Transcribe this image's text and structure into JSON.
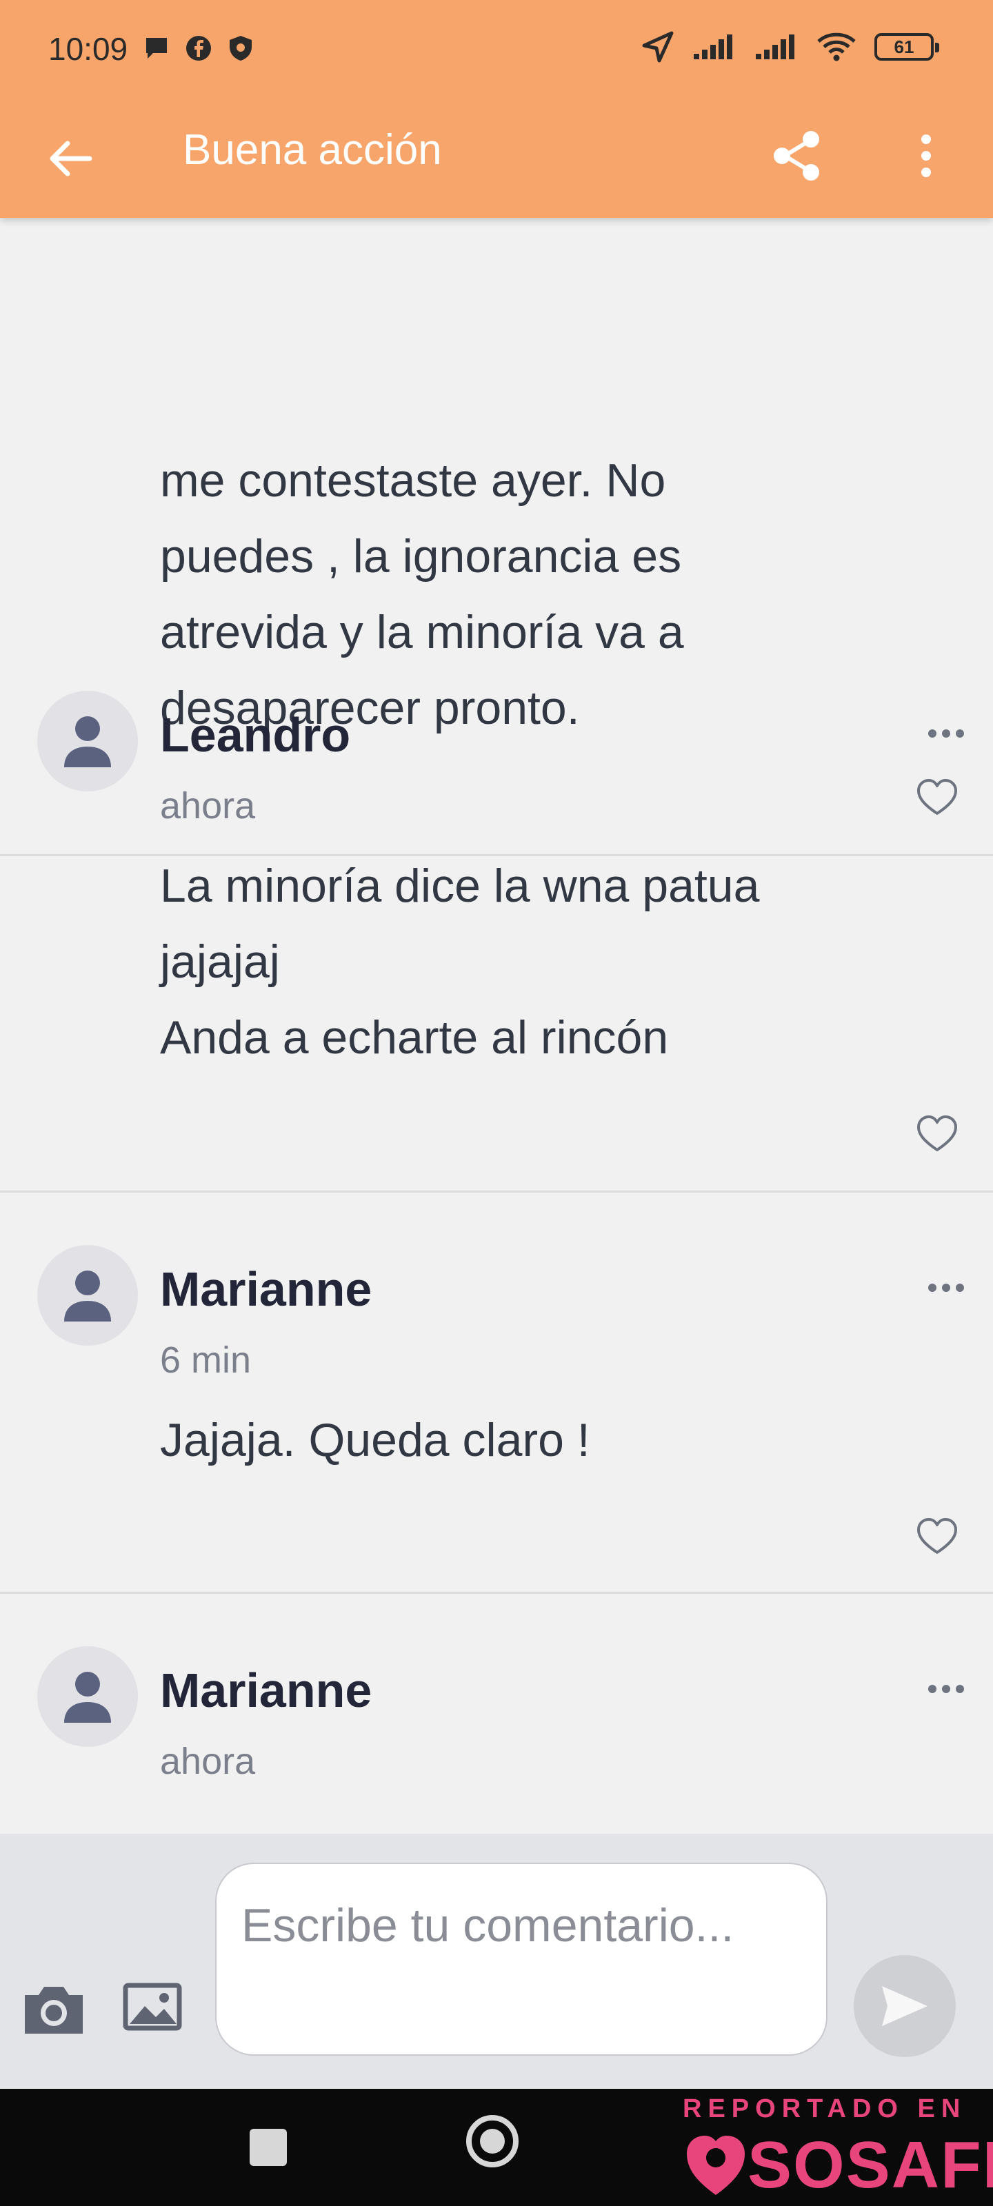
{
  "status_bar": {
    "time": "10:09",
    "battery": "61"
  },
  "header": {
    "title": "Buena acción"
  },
  "comments": [
    {
      "name": "",
      "time": "",
      "text": "me contestaste ayer. No\npuedes , la ignorancia es\natrevida y la minoría va a\ndesaparecer pronto."
    },
    {
      "name": "Leandro",
      "time": "ahora",
      "text": "La minoría dice la wna patua\njajajaj\nAnda a echarte al rincón"
    },
    {
      "name": "Marianne",
      "time": "6 min",
      "text": "Jajaja. Queda claro !"
    },
    {
      "name": "Marianne",
      "time": "ahora",
      "text": ""
    }
  ],
  "composer": {
    "placeholder": "Escribe tu comentario..."
  },
  "watermark": {
    "reported": "REPORTADO EN",
    "brand": "SOSAFE"
  },
  "colors": {
    "appbar": "#f7a56a",
    "watermark": "#e7457c"
  }
}
